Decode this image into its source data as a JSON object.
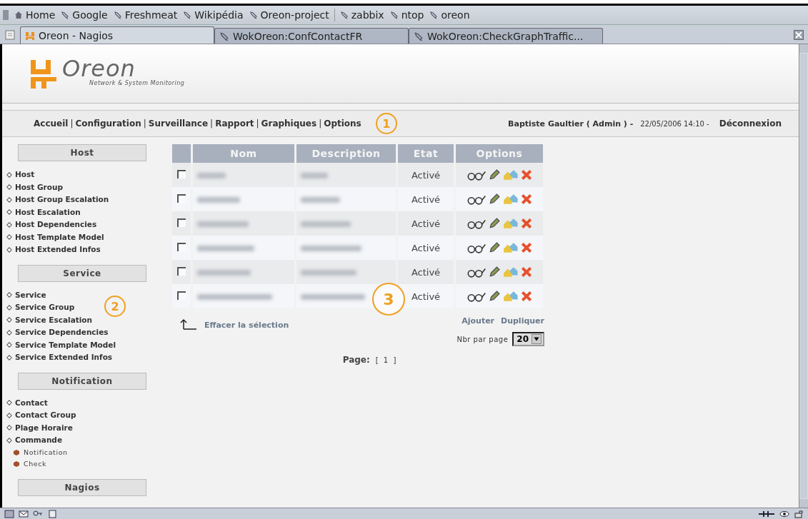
{
  "bookmarks": [
    {
      "label": "Home",
      "kind": "home"
    },
    {
      "label": "Google",
      "kind": "link"
    },
    {
      "label": "Freshmeat",
      "kind": "link"
    },
    {
      "label": "Wikipédia",
      "kind": "link"
    },
    {
      "label": "Oreon-project",
      "kind": "link"
    },
    {
      "kind": "separator"
    },
    {
      "label": "zabbix",
      "kind": "link"
    },
    {
      "label": "ntop",
      "kind": "link"
    },
    {
      "label": "oreon",
      "kind": "link"
    }
  ],
  "tabs": [
    {
      "label": "Oreon - Nagios",
      "selected": true
    },
    {
      "label": "WokOreon:ConfContactFR",
      "selected": false
    },
    {
      "label": "WokOreon:CheckGraphTraffic...",
      "selected": false
    }
  ],
  "header": {
    "logo": "Oreon",
    "tagline": "Network & System Monitoring"
  },
  "nav": {
    "items": [
      "Accueil",
      "Configuration",
      "Surveillance",
      "Rapport",
      "Graphiques",
      "Options"
    ],
    "separator": "|",
    "user": "Baptiste Gaultier ( Admin ) -",
    "datetime": "22/05/2006 14:10 -",
    "logout": "Déconnexion"
  },
  "sidebar": [
    {
      "title": "Host",
      "items": [
        {
          "label": "Host"
        },
        {
          "label": "Host Group"
        },
        {
          "label": "Host Group Escalation"
        },
        {
          "label": "Host Escalation"
        },
        {
          "label": "Host Dependencies"
        },
        {
          "label": "Host Template Model"
        },
        {
          "label": "Host Extended Infos"
        }
      ]
    },
    {
      "title": "Service",
      "items": [
        {
          "label": "Service"
        },
        {
          "label": "Service Group"
        },
        {
          "label": "Service Escalation"
        },
        {
          "label": "Service Dependencies"
        },
        {
          "label": "Service Template Model"
        },
        {
          "label": "Service Extended Infos"
        }
      ]
    },
    {
      "title": "Notification",
      "items": [
        {
          "label": "Contact"
        },
        {
          "label": "Contact Group"
        },
        {
          "label": "Plage Horaire"
        },
        {
          "label": "Commande",
          "children": [
            {
              "label": "Notification"
            },
            {
              "label": "Check"
            }
          ]
        }
      ]
    },
    {
      "title": "Nagios"
    }
  ],
  "table": {
    "columns": [
      "Nom",
      "Description",
      "Etat",
      "Options"
    ],
    "rows": [
      {
        "checked": false,
        "status": "Activé"
      },
      {
        "checked": false,
        "status": "Activé"
      },
      {
        "checked": false,
        "status": "Activé"
      },
      {
        "checked": false,
        "status": "Activé"
      },
      {
        "checked": false,
        "status": "Activé"
      },
      {
        "checked": false,
        "status": "Activé"
      }
    ]
  },
  "actions": {
    "clear_selection": "Effacer la sélection",
    "add": "Ajouter",
    "duplicate": "Dupliquer",
    "per_page_label": "Nbr par page",
    "per_page": "20"
  },
  "pagination": {
    "label": "Page:",
    "pages": "[ 1 ]"
  },
  "annotations": [
    "1",
    "2",
    "3"
  ]
}
